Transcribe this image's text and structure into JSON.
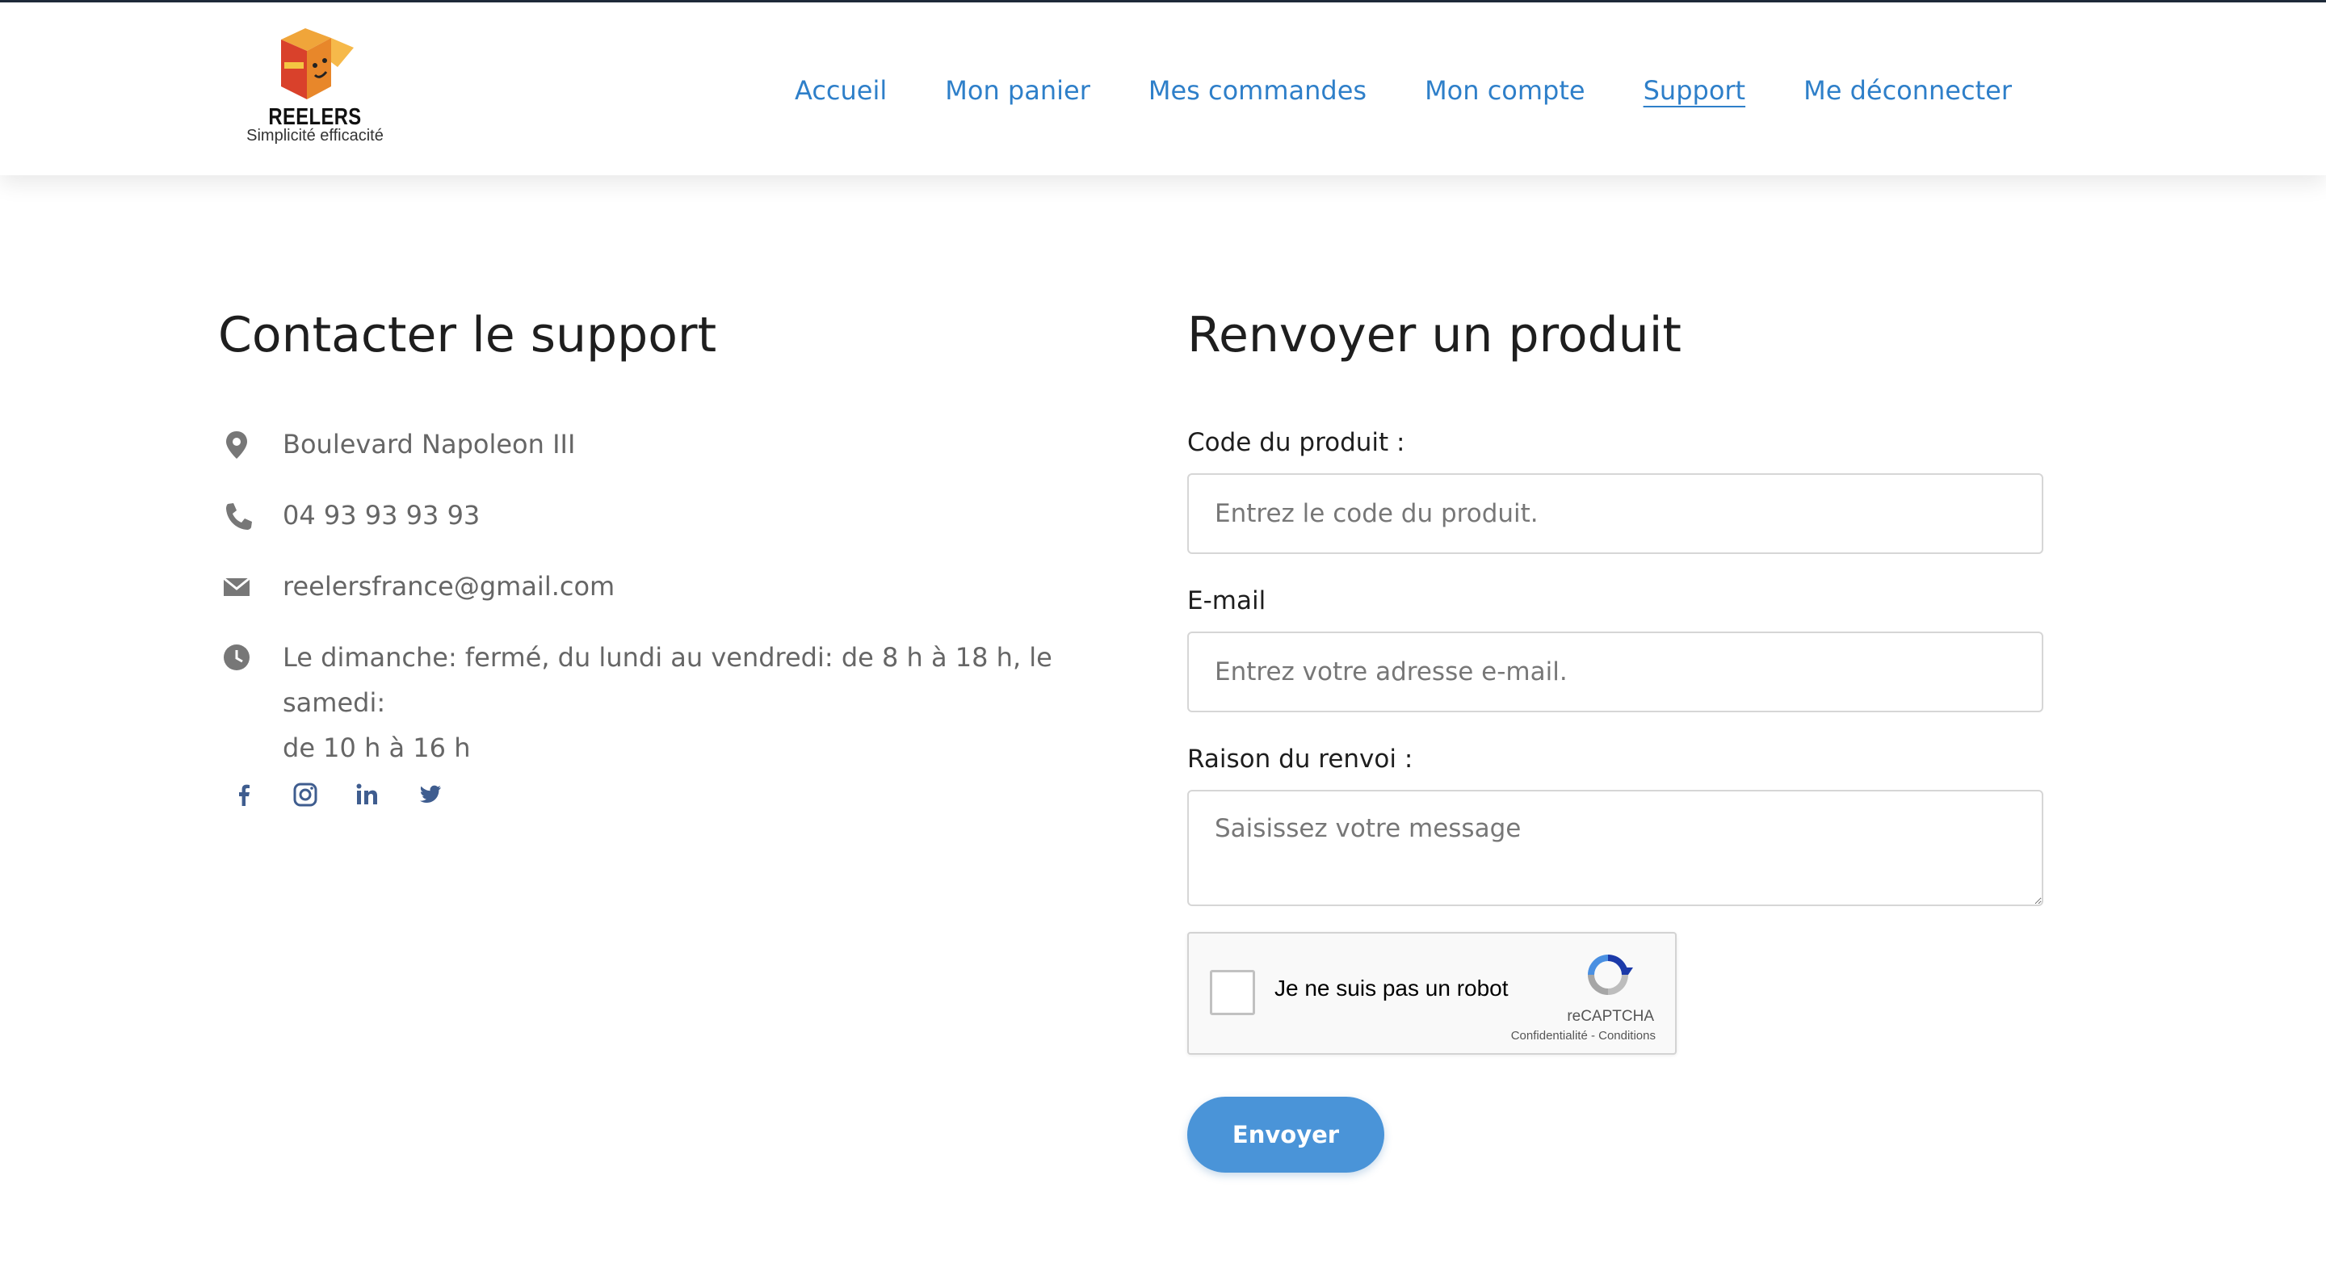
{
  "brand": {
    "name": "REELERS",
    "tagline": "Simplicité efficacité",
    "logo_icon": "box-icon"
  },
  "nav": {
    "items": [
      {
        "label": "Accueil"
      },
      {
        "label": "Mon panier"
      },
      {
        "label": "Mes commandes"
      },
      {
        "label": "Mon compte"
      },
      {
        "label": "Support",
        "active": true
      },
      {
        "label": "Me déconnecter"
      }
    ]
  },
  "contact": {
    "title": "Contacter le support",
    "address": "Boulevard Napoleon III",
    "phone": "04 93 93 93 93",
    "email": "reelersfrance@gmail.com",
    "hours_line1": "Le dimanche: fermé, du lundi au vendredi: de 8 h à 18 h, le samedi:",
    "hours_line2": "de 10 h à 16 h",
    "icons": [
      "location-pin-icon",
      "phone-icon",
      "mail-icon",
      "clock-icon"
    ],
    "social": [
      "facebook-icon",
      "instagram-icon",
      "linkedin-icon",
      "twitter-icon"
    ]
  },
  "return_form": {
    "title": "Renvoyer un produit",
    "code_label": "Code du produit :",
    "code_placeholder": "Entrez le code du produit.",
    "email_label": "E-mail",
    "email_placeholder": "Entrez votre adresse e-mail.",
    "reason_label": "Raison du renvoi :",
    "reason_placeholder": "Saisissez votre message",
    "captcha_text": "Je ne suis pas un robot",
    "captcha_brand": "reCAPTCHA",
    "captcha_links": "Confidentialité - Conditions",
    "submit_label": "Envoyer"
  },
  "colors": {
    "accent": "#2e7fc9",
    "button": "#4a94d8",
    "icon": "#777777",
    "social": "#3f5d8f"
  }
}
